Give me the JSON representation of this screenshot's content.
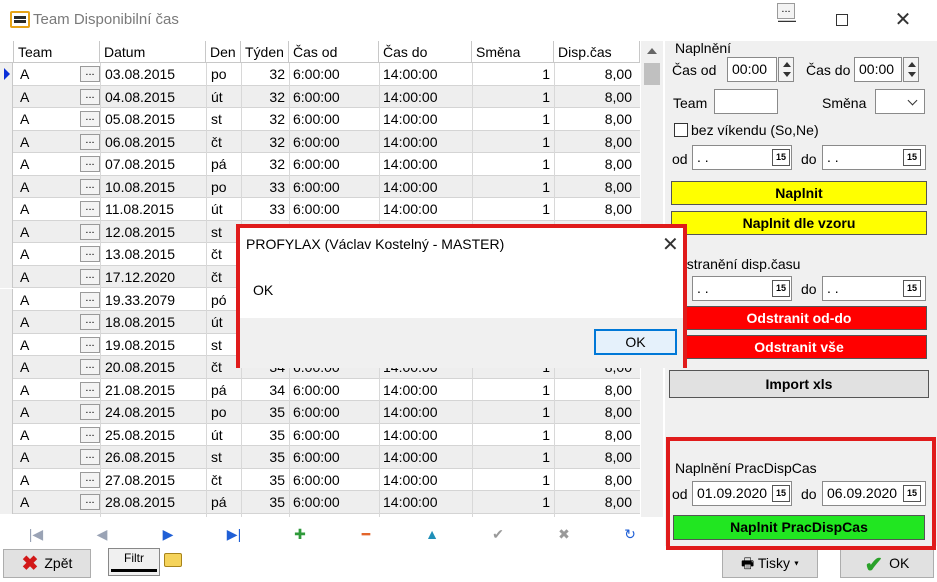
{
  "window": {
    "title": "Team Disponibilní čas"
  },
  "grid": {
    "columns": [
      "Team",
      "Datum",
      "Den",
      "Týden",
      "Čas od",
      "Čas do",
      "Směna",
      "Disp.čas"
    ],
    "rows": [
      {
        "team": "A",
        "date": "03.08.2015",
        "den": "po",
        "tyden": "32",
        "od": "6:00:00",
        "do": "14:00:00",
        "smena": "1",
        "disp": "8,00"
      },
      {
        "team": "A",
        "date": "04.08.2015",
        "den": "út",
        "tyden": "32",
        "od": "6:00:00",
        "do": "14:00:00",
        "smena": "1",
        "disp": "8,00"
      },
      {
        "team": "A",
        "date": "05.08.2015",
        "den": "st",
        "tyden": "32",
        "od": "6:00:00",
        "do": "14:00:00",
        "smena": "1",
        "disp": "8,00"
      },
      {
        "team": "A",
        "date": "06.08.2015",
        "den": "čt",
        "tyden": "32",
        "od": "6:00:00",
        "do": "14:00:00",
        "smena": "1",
        "disp": "8,00"
      },
      {
        "team": "A",
        "date": "07.08.2015",
        "den": "pá",
        "tyden": "32",
        "od": "6:00:00",
        "do": "14:00:00",
        "smena": "1",
        "disp": "8,00"
      },
      {
        "team": "A",
        "date": "10.08.2015",
        "den": "po",
        "tyden": "33",
        "od": "6:00:00",
        "do": "14:00:00",
        "smena": "1",
        "disp": "8,00"
      },
      {
        "team": "A",
        "date": "11.08.2015",
        "den": "út",
        "tyden": "33",
        "od": "6:00:00",
        "do": "14:00:00",
        "smena": "1",
        "disp": "8,00"
      },
      {
        "team": "A",
        "date": "12.08.2015",
        "den": "st",
        "tyden": "",
        "od": "",
        "do": "",
        "smena": "",
        "disp": ""
      },
      {
        "team": "A",
        "date": "13.08.2015",
        "den": "čt",
        "tyden": "",
        "od": "",
        "do": "",
        "smena": "",
        "disp": ""
      },
      {
        "team": "A",
        "date": "17.12.2020",
        "den": "čt",
        "tyden": "",
        "od": "",
        "do": "",
        "smena": "",
        "disp": ""
      },
      {
        "team": "A",
        "date": "19.33.2079",
        "den": "pó",
        "tyden": "",
        "od": "",
        "do": "",
        "smena": "",
        "disp": ""
      },
      {
        "team": "A",
        "date": "18.08.2015",
        "den": "út",
        "tyden": "",
        "od": "",
        "do": "",
        "smena": "",
        "disp": ""
      },
      {
        "team": "A",
        "date": "19.08.2015",
        "den": "st",
        "tyden": "",
        "od": "",
        "do": "",
        "smena": "",
        "disp": ""
      },
      {
        "team": "A",
        "date": "20.08.2015",
        "den": "čt",
        "tyden": "34",
        "od": "6:00:00",
        "do": "14:00:00",
        "smena": "1",
        "disp": "8,00"
      },
      {
        "team": "A",
        "date": "21.08.2015",
        "den": "pá",
        "tyden": "34",
        "od": "6:00:00",
        "do": "14:00:00",
        "smena": "1",
        "disp": "8,00"
      },
      {
        "team": "A",
        "date": "24.08.2015",
        "den": "po",
        "tyden": "35",
        "od": "6:00:00",
        "do": "14:00:00",
        "smena": "1",
        "disp": "8,00"
      },
      {
        "team": "A",
        "date": "25.08.2015",
        "den": "út",
        "tyden": "35",
        "od": "6:00:00",
        "do": "14:00:00",
        "smena": "1",
        "disp": "8,00"
      },
      {
        "team": "A",
        "date": "26.08.2015",
        "den": "st",
        "tyden": "35",
        "od": "6:00:00",
        "do": "14:00:00",
        "smena": "1",
        "disp": "8,00"
      },
      {
        "team": "A",
        "date": "27.08.2015",
        "den": "čt",
        "tyden": "35",
        "od": "6:00:00",
        "do": "14:00:00",
        "smena": "1",
        "disp": "8,00"
      },
      {
        "team": "A",
        "date": "28.08.2015",
        "den": "pá",
        "tyden": "35",
        "od": "6:00:00",
        "do": "14:00:00",
        "smena": "1",
        "disp": "8,00"
      }
    ],
    "dots_label": "..."
  },
  "navigator": {
    "icons": [
      "first-icon",
      "prev-icon",
      "next-icon",
      "last-icon",
      "add-icon",
      "delete-icon",
      "edit-icon",
      "post-icon",
      "cancel-icon",
      "refresh-icon"
    ],
    "glyphs": [
      "|◀",
      "◀",
      "▶",
      "▶|",
      "✚",
      "━",
      "▲",
      "✔",
      "✖",
      "↻"
    ],
    "colors": [
      "#9aa3b5",
      "#9aa3b5",
      "#1f5fd6",
      "#1f5fd6",
      "#2f9a3a",
      "#e3642a",
      "#1f8fb8",
      "#9a9a9a",
      "#9a9a9a",
      "#1f5fd6"
    ]
  },
  "bottom": {
    "back_label": "Zpět",
    "filter_label": "Filtr",
    "print_label": "Tisky ▾",
    "ok_label": "OK"
  },
  "panel": {
    "fill_group": "Naplnění",
    "time_from_label": "Čas od",
    "time_from_value": "00:00",
    "time_to_label": "Čas do",
    "time_to_value": "00:00",
    "team_label": "Team",
    "shift_label": "Směna",
    "no_weekend_label": "bez víkendu (So,Ne)",
    "od_label": "od",
    "do_label": "do",
    "empty_date": " .  .",
    "cal_label": "15",
    "fill_button": "Naplnit",
    "fill_pattern_button": "Naplnit dle vzoru",
    "remove_group": "dstranění disp.času",
    "remove_range_button": "Odstranit od-do",
    "remove_all_button": "Odstranit vše",
    "import_button": "Import xls",
    "prac_group": "Naplnění PracDispCas",
    "prac_from": "01.09.2020",
    "prac_to": "06.09.2020",
    "prac_button": "Naplnit PracDispCas",
    "colors": {
      "yellow": "#ffff00",
      "red": "#ff0000",
      "green": "#21e621",
      "highlight": "#e01b1b"
    }
  },
  "dialog": {
    "title": "PROFYLAX (Václav Kostelný - MASTER)",
    "message": "OK",
    "ok_label": "OK"
  }
}
